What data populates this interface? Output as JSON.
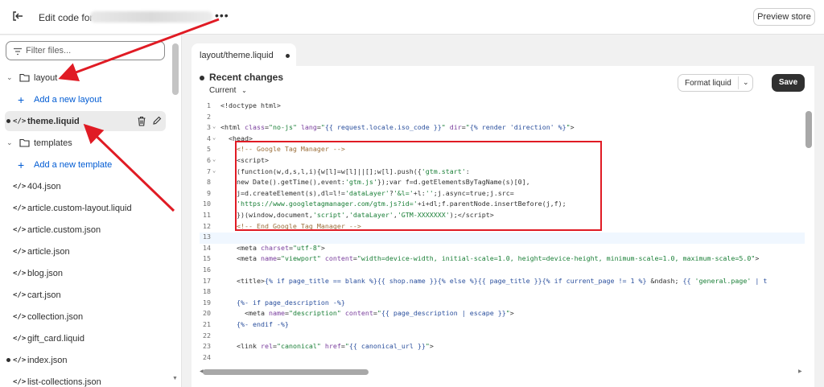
{
  "topbar": {
    "title": "Edit code for",
    "more": "•••",
    "preview_label": "Preview store"
  },
  "sidebar": {
    "filter_placeholder": "Filter files...",
    "items": [
      {
        "kind": "folder",
        "label": "layout"
      },
      {
        "kind": "add",
        "label": "Add a new layout"
      },
      {
        "kind": "file",
        "label": "theme.liquid",
        "selected": true,
        "modified": true
      },
      {
        "kind": "folder",
        "label": "templates"
      },
      {
        "kind": "add",
        "label": "Add a new template"
      },
      {
        "kind": "file",
        "label": "404.json"
      },
      {
        "kind": "file",
        "label": "article.custom-layout.liquid"
      },
      {
        "kind": "file",
        "label": "article.custom.json"
      },
      {
        "kind": "file",
        "label": "article.json"
      },
      {
        "kind": "file",
        "label": "blog.json"
      },
      {
        "kind": "file",
        "label": "cart.json"
      },
      {
        "kind": "file",
        "label": "collection.json"
      },
      {
        "kind": "file",
        "label": "gift_card.liquid"
      },
      {
        "kind": "file",
        "label": "index.json",
        "modified": true
      },
      {
        "kind": "file",
        "label": "list-collections.json"
      }
    ]
  },
  "tab": {
    "label": "layout/theme.liquid"
  },
  "panel": {
    "recent_changes": "Recent changes",
    "version": "Current",
    "format_label": "Format liquid",
    "save_label": "Save"
  },
  "editor": {
    "lines": [
      {
        "n": "1",
        "fold": "",
        "html": "<span class=\"tag\">&lt;!doctype html&gt;</span>"
      },
      {
        "n": "2",
        "fold": "",
        "html": ""
      },
      {
        "n": "3",
        "fold": "⌄",
        "html": "<span class=\"tag\">&lt;html</span> <span class=\"attr\">class</span>=<span class=\"str\">\"no-js\"</span> <span class=\"attr\">lang</span>=<span class=\"str\">\"<span class=\"lq\">{{ request.locale.iso_code }}</span>\"</span> <span class=\"attr\">dir</span>=<span class=\"str\">\"<span class=\"lq\">{% render 'direction' %}</span>\"</span><span class=\"tag\">&gt;</span>"
      },
      {
        "n": "4",
        "fold": "⌄",
        "html": "  <span class=\"tag\">&lt;head&gt;</span>"
      },
      {
        "n": "5",
        "fold": "",
        "html": "    <span class=\"cm\">&lt;!-- Google Tag Manager --&gt;</span>"
      },
      {
        "n": "6",
        "fold": "⌄",
        "html": "    <span class=\"tag\">&lt;script&gt;</span>"
      },
      {
        "n": "7",
        "fold": "⌄",
        "html": "    (function(w,d,s,l,i){w[l]=w[l]||[];w[l].push({<span class=\"str\">'gtm.start'</span>:"
      },
      {
        "n": "8",
        "fold": "",
        "html": "    new Date().getTime(),event:<span class=\"str\">'gtm.js'</span>});var f=d.getElementsByTagName(s)[0],"
      },
      {
        "n": "9",
        "fold": "",
        "html": "    j=d.createElement(s),dl=l!=<span class=\"str\">'dataLayer'</span>?<span class=\"str\">'&amp;l='</span>+l:<span class=\"str\">''</span>;j.async=true;j.src="
      },
      {
        "n": "10",
        "fold": "",
        "html": "    <span class=\"str\">'https://www.googletagmanager.com/gtm.js?id='</span>+i+dl;f.parentNode.insertBefore(j,f);"
      },
      {
        "n": "11",
        "fold": "",
        "html": "    })(window,document,<span class=\"str\">'script'</span>,<span class=\"str\">'dataLayer'</span>,<span class=\"str\">'GTM-XXXXXXX'</span>);<span class=\"tag\">&lt;/script&gt;</span>"
      },
      {
        "n": "12",
        "fold": "",
        "html": "    <span class=\"cm\">&lt;!-- End Google Tag Manager --&gt;</span>"
      },
      {
        "n": "13",
        "fold": "",
        "html": "",
        "active": true
      },
      {
        "n": "14",
        "fold": "",
        "html": "    <span class=\"tag\">&lt;meta</span> <span class=\"attr\">charset</span>=<span class=\"str\">\"utf-8\"</span><span class=\"tag\">&gt;</span>"
      },
      {
        "n": "15",
        "fold": "",
        "html": "    <span class=\"tag\">&lt;meta</span> <span class=\"attr\">name</span>=<span class=\"str\">\"viewport\"</span> <span class=\"attr\">content</span>=<span class=\"str\">\"width=device-width, initial-scale=1.0, height=device-height, minimum-scale=1.0, maximum-scale=5.0\"</span><span class=\"tag\">&gt;</span>"
      },
      {
        "n": "16",
        "fold": "",
        "html": ""
      },
      {
        "n": "17",
        "fold": "",
        "html": "    <span class=\"tag\">&lt;title&gt;</span><span class=\"lq\">{% if page_title == blank %}{{ shop.name }}{% else %}{{ page_title }}{% if current_page != 1 %}</span> &amp;ndash; <span class=\"lq\">{{ <span class=\"str\">'general.page'</span> | t</span>"
      },
      {
        "n": "18",
        "fold": "",
        "html": ""
      },
      {
        "n": "19",
        "fold": "",
        "html": "    <span class=\"lq\">{%- if page_description -%}</span>"
      },
      {
        "n": "20",
        "fold": "",
        "html": "      <span class=\"tag\">&lt;meta</span> <span class=\"attr\">name</span>=<span class=\"str\">\"description\"</span> <span class=\"attr\">content</span>=<span class=\"str\">\"<span class=\"lq\">{{ page_description | escape }}</span>\"</span><span class=\"tag\">&gt;</span>"
      },
      {
        "n": "21",
        "fold": "",
        "html": "    <span class=\"lq\">{%- endif -%}</span>"
      },
      {
        "n": "22",
        "fold": "",
        "html": ""
      },
      {
        "n": "23",
        "fold": "",
        "html": "    <span class=\"tag\">&lt;link</span> <span class=\"attr\">rel</span>=<span class=\"str\">\"canonical\"</span> <span class=\"attr\">href</span>=<span class=\"str\">\"<span class=\"lq\">{{ canonical_url }}</span>\"</span><span class=\"tag\">&gt;</span>"
      },
      {
        "n": "24",
        "fold": "",
        "html": ""
      }
    ]
  },
  "colors": {
    "annotation": "#e01b24",
    "link": "#005bd3",
    "save_bg": "#303030"
  }
}
